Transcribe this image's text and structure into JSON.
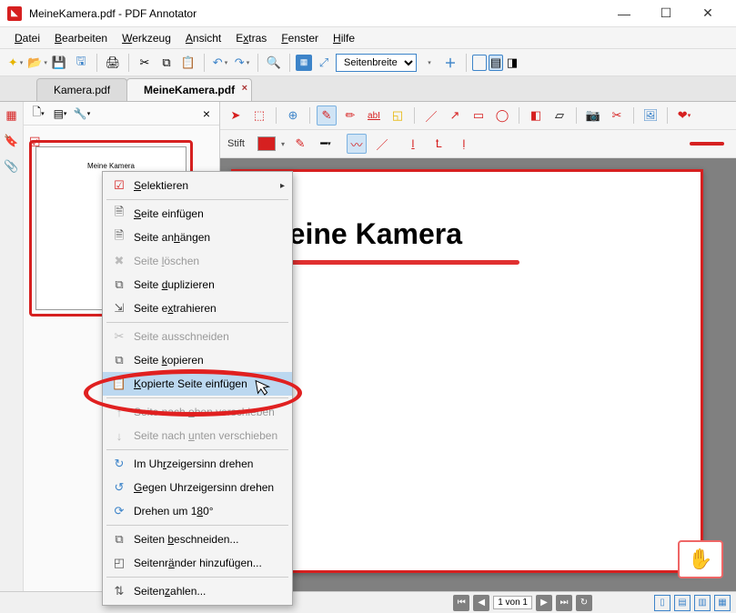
{
  "window": {
    "title": "MeineKamera.pdf - PDF Annotator"
  },
  "menu": {
    "datei": "Datei",
    "bearbeiten": "Bearbeiten",
    "werkzeug": "Werkzeug",
    "ansicht": "Ansicht",
    "extras": "Extras",
    "fenster": "Fenster",
    "hilfe": "Hilfe"
  },
  "pagesize_select": "Seitenbreite",
  "tabs": {
    "kamera": "Kamera.pdf",
    "meinekamera": "MeineKamera.pdf"
  },
  "tooltb2_label": "Stift",
  "document": {
    "heading": "Meine Kamera",
    "thumb_heading": "Meine Kamera"
  },
  "status": {
    "page": "1 von 1"
  },
  "context_menu": {
    "selektieren": "Selektieren",
    "seite_einfuegen": "Seite einfügen",
    "seite_anhaengen": "Seite anhängen",
    "seite_loeschen": "Seite löschen",
    "seite_duplizieren": "Seite duplizieren",
    "seite_extrahieren": "Seite extrahieren",
    "seite_ausschneiden": "Seite ausschneiden",
    "seite_kopieren": "Seite kopieren",
    "kopierte_seite_einfuegen": "Kopierte Seite einfügen",
    "seite_nach_oben": "Seite nach oben verschieben",
    "seite_nach_unten": "Seite nach unten verschieben",
    "uhrzeigersinn": "Im Uhrzeigersinn drehen",
    "gegen_uhrzeigersinn": "Gegen Uhrzeigersinn drehen",
    "drehen_180": "Drehen um 180°",
    "beschneiden": "Seiten beschneiden...",
    "seitenraender": "Seitenränder hinzufügen...",
    "seitenzahlen": "Seitenzahlen..."
  }
}
